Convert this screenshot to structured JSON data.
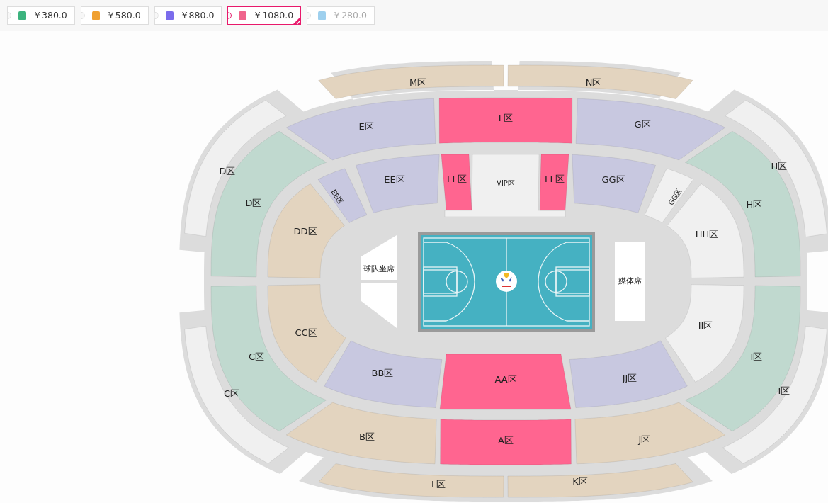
{
  "price_tiers": [
    {
      "label": "￥380.0",
      "color": "#3cb37e",
      "selected": false,
      "disabled": false
    },
    {
      "label": "￥580.0",
      "color": "#f0a030",
      "selected": false,
      "disabled": false
    },
    {
      "label": "￥880.0",
      "color": "#7b6cec",
      "selected": false,
      "disabled": false
    },
    {
      "label": "￥1080.0",
      "color": "#f0648c",
      "selected": true,
      "disabled": false
    },
    {
      "label": "￥280.0",
      "color": "#9ed0ee",
      "selected": false,
      "disabled": true
    }
  ],
  "sections": [
    {
      "label": "M区",
      "color": "#e3d4bf"
    },
    {
      "label": "N区",
      "color": "#e3d4bf"
    },
    {
      "label": "E区",
      "color": "#c8c8e0"
    },
    {
      "label": "F区",
      "color": "#ff6590"
    },
    {
      "label": "G区",
      "color": "#c8c8e0"
    },
    {
      "label": "D区",
      "color": "#f0f0f0"
    },
    {
      "label": "D区",
      "color": "#c0d9cf"
    },
    {
      "label": "H区",
      "color": "#f0f0f0"
    },
    {
      "label": "H区",
      "color": "#c0d9cf"
    },
    {
      "label": "EE区",
      "color": "#c8c8e0"
    },
    {
      "label": "FF区",
      "color": "#ff6590"
    },
    {
      "label": "VIP区",
      "color": "#f0f0f0"
    },
    {
      "label": "FF区",
      "color": "#ff6590"
    },
    {
      "label": "GG区",
      "color": "#c8c8e0"
    },
    {
      "label": "EE区",
      "color": "#c8c8e0"
    },
    {
      "label": "GG区",
      "color": "#f0f0f0"
    },
    {
      "label": "DD区",
      "color": "#e3d4bf"
    },
    {
      "label": "HH区",
      "color": "#f0f0f0"
    },
    {
      "label": "CC区",
      "color": "#e3d4bf"
    },
    {
      "label": "II区",
      "color": "#f0f0f0"
    },
    {
      "label": "C区",
      "color": "#c0d9cf"
    },
    {
      "label": "I区",
      "color": "#c0d9cf"
    },
    {
      "label": "C区",
      "color": "#f0f0f0"
    },
    {
      "label": "I区",
      "color": "#f0f0f0"
    },
    {
      "label": "BB区",
      "color": "#c8c8e0"
    },
    {
      "label": "AA区",
      "color": "#ff6590"
    },
    {
      "label": "JJ区",
      "color": "#c8c8e0"
    },
    {
      "label": "B区",
      "color": "#e3d4bf"
    },
    {
      "label": "A区",
      "color": "#ff6590"
    },
    {
      "label": "J区",
      "color": "#e3d4bf"
    },
    {
      "label": "L区",
      "color": "#e3d4bf"
    },
    {
      "label": "K区",
      "color": "#e3d4bf"
    }
  ],
  "court": {
    "team_bench": "球队坐席",
    "media": "媒体席"
  }
}
